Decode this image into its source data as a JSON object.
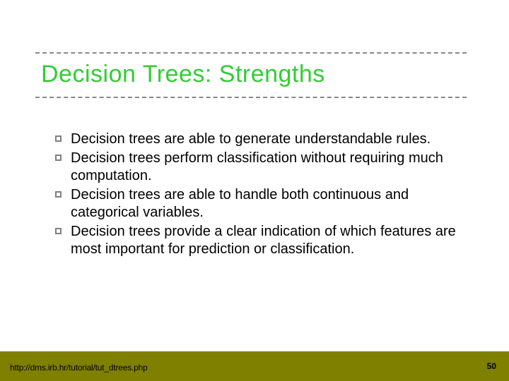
{
  "title": "Decision Trees: Strengths",
  "bullets": [
    "Decision trees are able to generate understandable rules.",
    "Decision trees perform classification without requiring much computation.",
    "Decision trees are able to handle both continuous and categorical variables.",
    "Decision trees provide a clear indication of which features are most important for prediction or classification."
  ],
  "footer_url": "http://dms.irb.hr/tutorial/tut_dtrees.php",
  "page_number": "50"
}
